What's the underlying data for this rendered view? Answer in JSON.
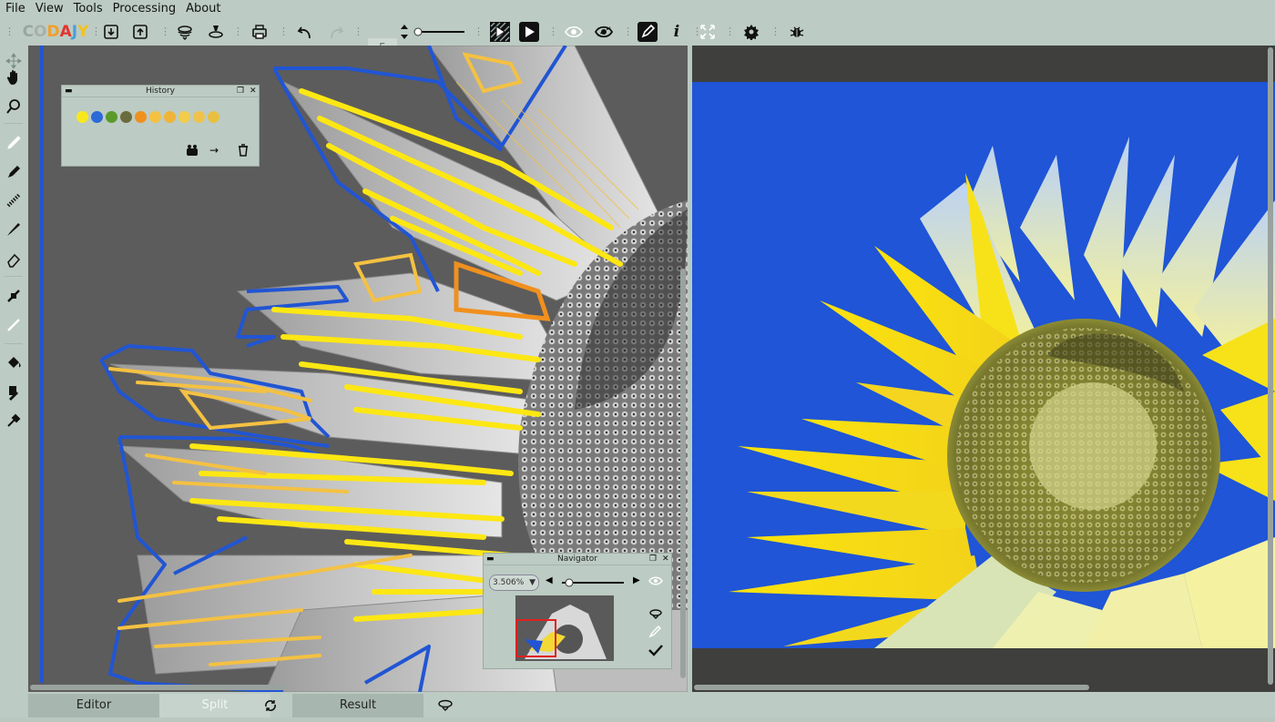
{
  "menu": [
    "File",
    "View",
    "Tools",
    "Processing",
    "About"
  ],
  "logo": {
    "letters": [
      "C",
      "O",
      "D",
      "A",
      "J",
      "Y"
    ],
    "colors": [
      "#9aa7a1",
      "#a6b0ab",
      "#f1a02c",
      "#e2342f",
      "#4a9fd9",
      "#f4c21a"
    ]
  },
  "toolbar": {
    "brush_size": "5",
    "icons": [
      "save-icon",
      "export-icon",
      "layers-icon",
      "stamp-icon",
      "print-icon",
      "undo-icon",
      "redo-icon",
      "mask-icon",
      "play-icon",
      "eye-icon",
      "eye-hidden-icon",
      "pen-mode-icon",
      "info-icon",
      "fit-icon",
      "settings-icon",
      "bug-icon"
    ]
  },
  "sidebar_tools": [
    "move-icon",
    "pan-hand-icon",
    "zoom-icon",
    "marker-icon",
    "pencil-icon",
    "spray-icon",
    "brush-icon",
    "eraser-icon",
    "connect-icon",
    "line-icon",
    "fill-icon",
    "stamp-tool-icon",
    "eyedropper-icon"
  ],
  "history": {
    "title": "History",
    "swatches": [
      "#f7e81e",
      "#2d6ad8",
      "#5a9a2c",
      "#6b6c3e",
      "#f0901e",
      "#f4c142",
      "#f0b43a",
      "#f2cc4a",
      "#efc24c",
      "#e8c040"
    ]
  },
  "navigator": {
    "title": "Navigator",
    "zoom": "3.506%"
  },
  "bottom": {
    "editor": "Editor",
    "split": "Split",
    "result": "Result"
  },
  "colors": {
    "accent_blue": "#2155d3",
    "sky": "#1f55d6",
    "bg": "#bccbc3"
  }
}
